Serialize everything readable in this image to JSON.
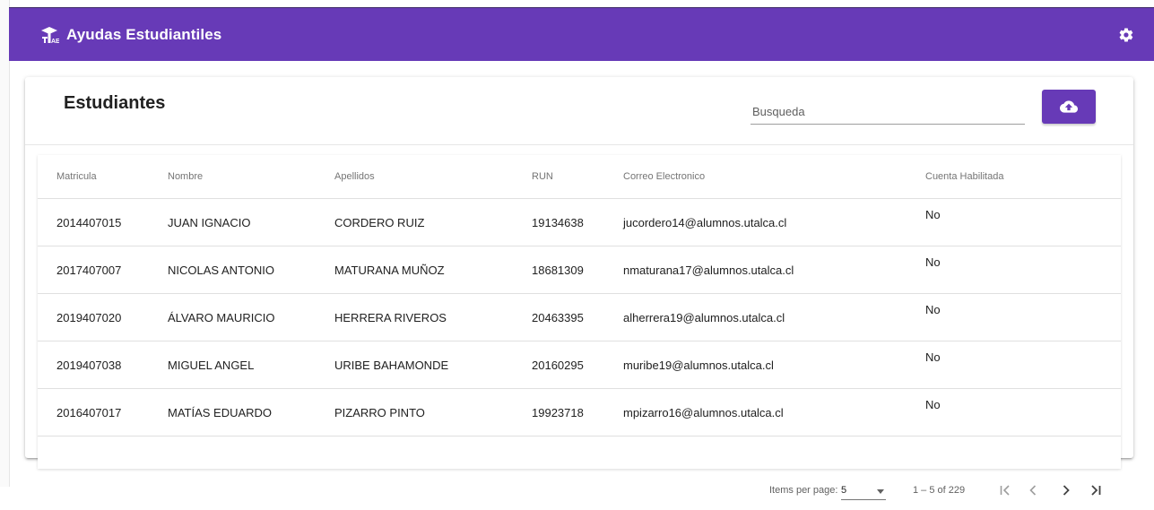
{
  "app": {
    "title": "Ayudas Estudiantiles"
  },
  "colors": {
    "primary": "#673ab7",
    "text": "#212121",
    "muted": "#757575"
  },
  "icons": {
    "brand": "graduation-cap-logo",
    "settings": "gear-icon",
    "upload": "cloud-upload-icon"
  },
  "page": {
    "title": "Estudiantes"
  },
  "search": {
    "placeholder": "Busqueda",
    "value": ""
  },
  "table": {
    "columns": [
      "Matricula",
      "Nombre",
      "Apellidos",
      "RUN",
      "Correo Electronico",
      "Cuenta Habilitada"
    ],
    "rows": [
      [
        "2014407015",
        "JUAN IGNACIO",
        "CORDERO RUIZ",
        "19134638",
        "jucordero14@alumnos.utalca.cl",
        "No"
      ],
      [
        "2017407007",
        "NICOLAS ANTONIO",
        "MATURANA MUÑOZ",
        "18681309",
        "nmaturana17@alumnos.utalca.cl",
        "No"
      ],
      [
        "2019407020",
        "ÁLVARO MAURICIO",
        "HERRERA RIVEROS",
        "20463395",
        "alherrera19@alumnos.utalca.cl",
        "No"
      ],
      [
        "2019407038",
        "MIGUEL ANGEL",
        "URIBE BAHAMONDE",
        "20160295",
        "muribe19@alumnos.utalca.cl",
        "No"
      ],
      [
        "2016407017",
        "MATÍAS EDUARDO",
        "PIZARRO PINTO",
        "19923718",
        "mpizarro16@alumnos.utalca.cl",
        "No"
      ]
    ]
  },
  "paginator": {
    "items_per_page_label": "Items per page:",
    "items_per_page": "5",
    "range_label": "1 – 5 of 229"
  }
}
